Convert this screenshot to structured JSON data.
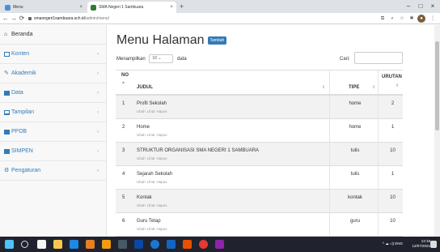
{
  "browser": {
    "tabs": [
      {
        "label": "Menu",
        "active": false
      },
      {
        "label": "SMA Negeri 1 Sambuara",
        "active": true
      }
    ],
    "new_tab_icon": "+",
    "address": {
      "host": "smanegeri1sambuara.sch.id",
      "path": "/admin/menu/"
    },
    "window_controls": [
      "–",
      "□",
      "×"
    ],
    "nav_icons": [
      "back-icon",
      "forward-icon",
      "reload-icon"
    ]
  },
  "sidebar": {
    "items": [
      {
        "label": "Beranda",
        "icon": "home-icon",
        "chevron": false
      },
      {
        "label": "Konten",
        "icon": "content-icon",
        "chevron": true
      },
      {
        "label": "Akademik",
        "icon": "pencil-icon",
        "chevron": true
      },
      {
        "label": "Data",
        "icon": "data-icon",
        "chevron": true
      },
      {
        "label": "Tampilan",
        "icon": "monitor-icon",
        "chevron": true
      },
      {
        "label": "PPDB",
        "icon": "list-icon",
        "chevron": true
      },
      {
        "label": "SIMPEN",
        "icon": "list-icon",
        "chevron": true
      },
      {
        "label": "Pengaturan",
        "icon": "gear-icon",
        "chevron": true
      }
    ],
    "chevron_glyph": "‹"
  },
  "main": {
    "title": "Menu Halaman",
    "add_badge": "Tambah",
    "length": {
      "before": "Menampilkan",
      "value": "10",
      "after": "data"
    },
    "search_label": "Cari:",
    "search_value": "",
    "columns": {
      "no": "NO",
      "judul": "JUDUL",
      "tipe": "TIPE",
      "urutan": "URUTAN"
    },
    "row_actions": [
      "Ubah",
      "Lihat",
      "Hapus"
    ],
    "rows": [
      {
        "no": "1",
        "judul": "Profil Sekolah",
        "tipe": "home",
        "urutan": "2"
      },
      {
        "no": "2",
        "judul": "Home",
        "tipe": "home",
        "urutan": "1"
      },
      {
        "no": "3",
        "judul": "STRUKTUR ORGANISASI SMA NEGERI 1 SAMBUARA",
        "tipe": "tulis",
        "urutan": "10"
      },
      {
        "no": "4",
        "judul": "Sejarah Sekolah",
        "tipe": "tulis",
        "urutan": "1"
      },
      {
        "no": "5",
        "judul": "Kontak",
        "tipe": "kontak",
        "urutan": "10"
      },
      {
        "no": "6",
        "judul": "Guru Tetap",
        "tipe": "guru",
        "urutan": "10"
      }
    ]
  },
  "taskbar": {
    "tray": "^ ☁ ◁) ENG",
    "time": "13:18",
    "date": "12/07/2021"
  },
  "colors": {
    "accent": "#337ab7",
    "taskbar": "#20232e",
    "sidebar_bg": "#f8f8f8",
    "stripe": "#f2f2f2"
  }
}
